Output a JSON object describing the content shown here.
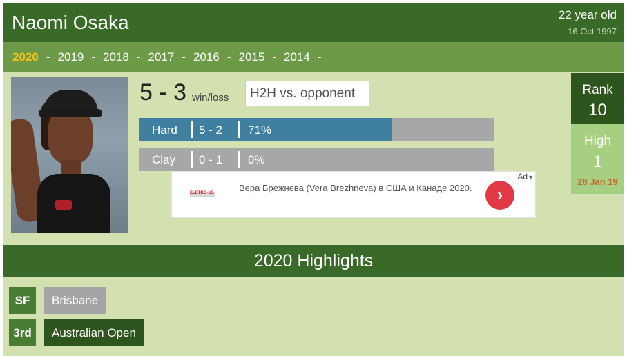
{
  "player": {
    "name": "Naomi Osaka",
    "age": "22 year old",
    "dob": "16 Oct 1997"
  },
  "years": [
    "2020",
    "2019",
    "2018",
    "2017",
    "2016",
    "2015",
    "2014"
  ],
  "active_year": "2020",
  "record": {
    "score": "5 - 3",
    "label": "win/loss"
  },
  "h2h": {
    "placeholder": "H2H vs. opponent"
  },
  "surfaces": [
    {
      "name": "Hard",
      "wl": "5 - 2",
      "pct": "71%",
      "fill_fraction": 0.71
    },
    {
      "name": "Clay",
      "wl": "0 - 1",
      "pct": "0%",
      "fill_fraction": 0.0
    }
  ],
  "ad": {
    "logo": "ELETRO·US",
    "text": "Вера Брежнева (Vera Brezhneva) в США и Канаде 2020.",
    "badge": "Ad",
    "badge_icon": "chevron-down-icon",
    "arrow": "›",
    "arrow_color": "#e23744"
  },
  "rank": {
    "label": "Rank",
    "value": "10"
  },
  "high": {
    "label": "High",
    "value": "1",
    "date": "28 Jan 19"
  },
  "highlights": {
    "title": "2020 Highlights",
    "items": [
      {
        "round": "SF",
        "tournament": "Brisbane"
      },
      {
        "round": "3rd",
        "tournament": "Australian Open"
      }
    ]
  },
  "colors": {
    "header_green": "#3a6a27",
    "years_bar": "#6c9a46",
    "active_year": "#f3c21c",
    "page_bg": "#d3e0b0",
    "surface_fill": "#3f7fa0",
    "surface_bg": "#a7a7a7",
    "rank_box": "#2f551f",
    "high_box": "#a6cf82",
    "high_date": "#c0672a"
  }
}
